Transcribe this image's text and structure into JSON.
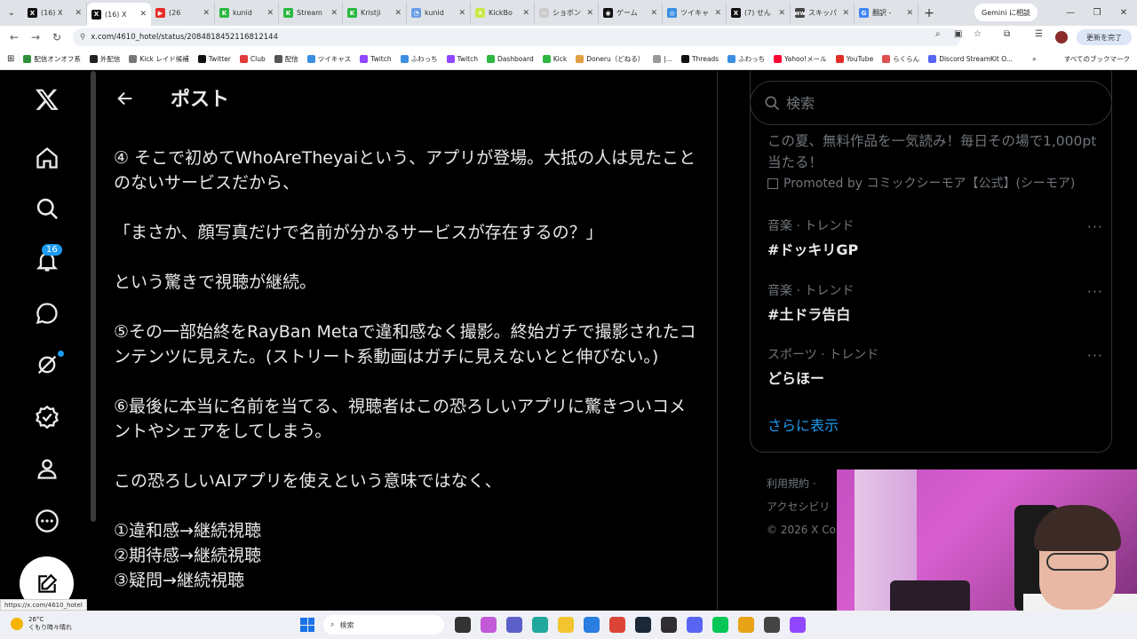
{
  "browser": {
    "tabs": [
      {
        "label": "(16) X",
        "color": "#111111",
        "glyph": "X"
      },
      {
        "label": "(16) X",
        "color": "#111111",
        "glyph": "X",
        "active": true
      },
      {
        "label": "(26",
        "color": "#e52d27",
        "glyph": "▶"
      },
      {
        "label": "kunid",
        "color": "#2bb741",
        "glyph": "K"
      },
      {
        "label": "Stream",
        "color": "#2bb741",
        "glyph": "K"
      },
      {
        "label": "Kristji",
        "color": "#2bb741",
        "glyph": "K"
      },
      {
        "label": "kunid",
        "color": "#6a9fe6",
        "glyph": "◔"
      },
      {
        "label": "KickBo",
        "color": "#c9e84c",
        "glyph": "✦"
      },
      {
        "label": "ショボン",
        "color": "#cccccc",
        "glyph": "・"
      },
      {
        "label": "ゲーム",
        "color": "#111111",
        "glyph": "◉"
      },
      {
        "label": "ツイキャ",
        "color": "#3b8ee0",
        "glyph": "◎"
      },
      {
        "label": "(7) せん",
        "color": "#111111",
        "glyph": "X"
      },
      {
        "label": "スキッパ",
        "color": "#444444",
        "glyph": "ww"
      },
      {
        "label": "翻訳 -",
        "color": "#4285f4",
        "glyph": "G"
      }
    ],
    "gemini_button": "Gemini に相談",
    "url": "x.com/4610_hotel/status/2084818452116812144",
    "update_button": "更新を完了",
    "bookmarks": [
      {
        "label": "配信オンオフ系",
        "color": "#2f8f3a"
      },
      {
        "label": "外配信",
        "color": "#222222"
      },
      {
        "label": "Kick レイド候補",
        "color": "#777777"
      },
      {
        "label": "Twitter",
        "color": "#111111"
      },
      {
        "label": "Club",
        "color": "#e03a3a"
      },
      {
        "label": "配信",
        "color": "#555555"
      },
      {
        "label": "ツイキャス",
        "color": "#3b8ee0"
      },
      {
        "label": "Twitch",
        "color": "#9146ff"
      },
      {
        "label": "ふわっち",
        "color": "#3b8ee0"
      },
      {
        "label": "Twitch",
        "color": "#9146ff"
      },
      {
        "label": "Dashboard",
        "color": "#2bb741"
      },
      {
        "label": "Kick",
        "color": "#2bb741"
      },
      {
        "label": "Doneru（どねる）",
        "color": "#e0a040"
      },
      {
        "label": "|...",
        "color": "#999999"
      },
      {
        "label": "Threads",
        "color": "#111111"
      },
      {
        "label": "ふわっち",
        "color": "#3b8ee0"
      },
      {
        "label": "Yahoo!メール",
        "color": "#ff0033"
      },
      {
        "label": "YouTube",
        "color": "#e52d27"
      },
      {
        "label": "らくらん",
        "color": "#e05050"
      },
      {
        "label": "Discord StreamKit O...",
        "color": "#5865f2"
      }
    ],
    "all_bookmarks": "すべてのブックマーク"
  },
  "x": {
    "notification_count": "16",
    "header_title": "ポスト",
    "post_paragraphs": [
      "④ そこで初めてWhoAreTheyaiという、アプリが登場。大抵の人は見たことのないサービスだから、",
      "「まさか、顔写真だけで名前が分かるサービスが存在するの？」",
      "という驚きで視聴が継続。",
      "⑤その一部始終をRayBan Metaで違和感なく撮影。終始ガチで撮影されたコンテンツに見えた。(ストリート系動画はガチに見えないとと伸びない。)",
      "⑥最後に本当に名前を当てる、視聴者はこの恐ろしいアプリに驚きついコメントやシェアをしてしまう。",
      "この恐ろしいAIアプリを使えという意味ではなく、"
    ],
    "post_list": [
      "①違和感→継続視聴",
      "②期待感→継続視聴",
      "③疑問→継続視聴"
    ],
    "search_placeholder": "検索",
    "promo_text": "この夏、無料作品を一気読み！毎日その場で1,000pt当たる！",
    "promo_by": "Promoted by コミックシーモア【公式】(シーモア)",
    "trends": [
      {
        "category": "音楽 · トレンド",
        "tag": "#ドッキリGP"
      },
      {
        "category": "音楽 · トレンド",
        "tag": "#土ドラ告白"
      },
      {
        "category": "スポーツ · トレンド",
        "tag": "どらほー"
      }
    ],
    "more_glyph": "···",
    "show_more": "さらに表示",
    "footer": [
      "利用規約 ·",
      "アクセシビリ",
      "© 2026 X Cor"
    ]
  },
  "status_link": "https://x.com/4610_hotel",
  "taskbar": {
    "weather_temp": "26°C",
    "weather_desc": "くもり時々晴れ",
    "search_placeholder": "検索",
    "icons": [
      {
        "name": "task-view-icon",
        "color": "#333333"
      },
      {
        "name": "copilot-icon",
        "color": "#c25ad7"
      },
      {
        "name": "teams-icon",
        "color": "#5b5fc7"
      },
      {
        "name": "edge-icon",
        "color": "#1fa89b"
      },
      {
        "name": "file-explorer-icon",
        "color": "#f2c530"
      },
      {
        "name": "store-icon",
        "color": "#2a7de1"
      },
      {
        "name": "chrome-icon",
        "color": "#db4437"
      },
      {
        "name": "steam-icon",
        "color": "#1b2838"
      },
      {
        "name": "obs-icon",
        "color": "#302e31"
      },
      {
        "name": "discord-icon",
        "color": "#5865f2"
      },
      {
        "name": "line-icon",
        "color": "#06c755"
      },
      {
        "name": "app-icon",
        "color": "#e8a317"
      },
      {
        "name": "app-icon-2",
        "color": "#444444"
      },
      {
        "name": "app-icon-3",
        "color": "#9146ff"
      }
    ]
  }
}
